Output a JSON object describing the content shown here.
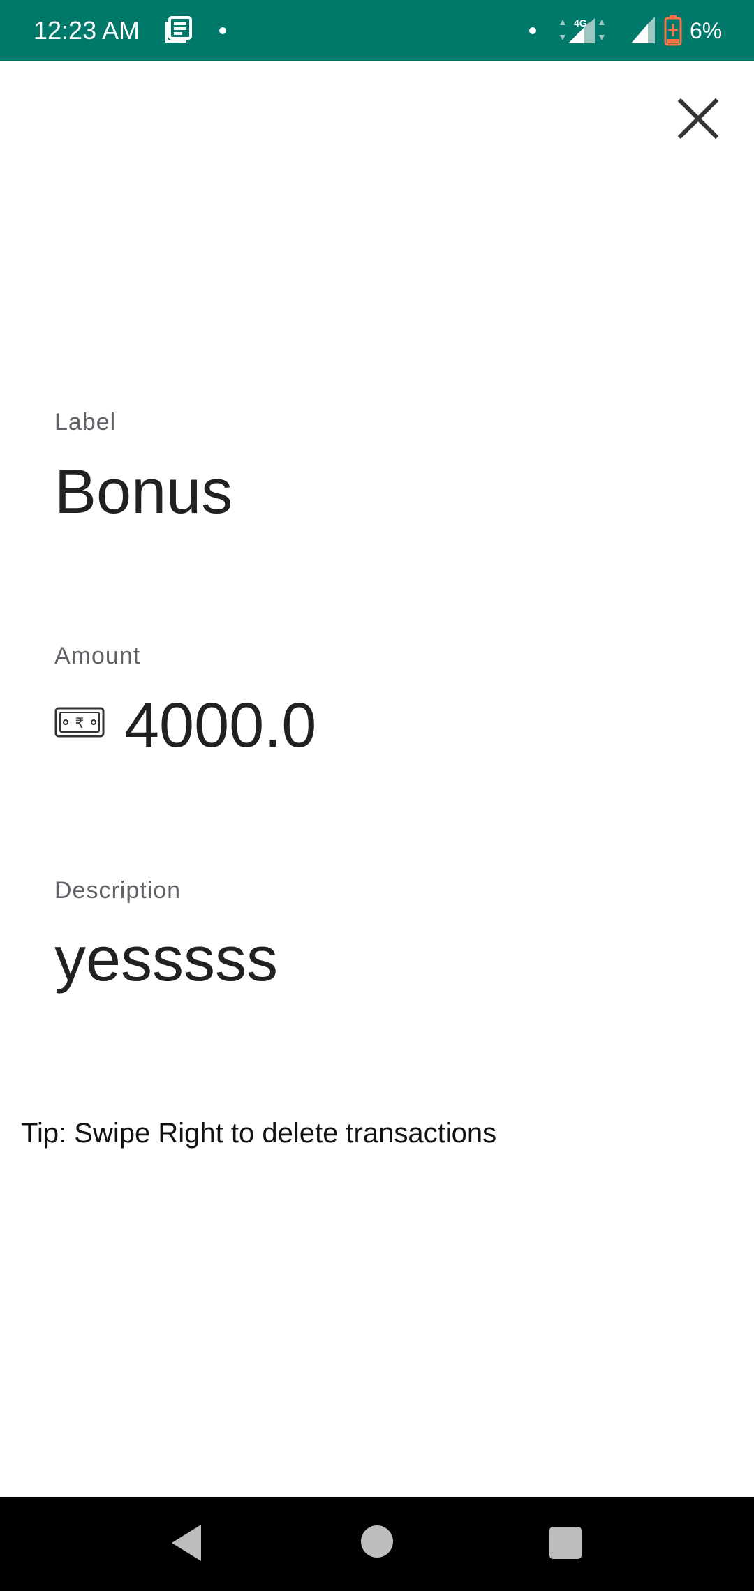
{
  "status_bar": {
    "time": "12:23 AM",
    "network": "4G",
    "battery": "6%",
    "icons": [
      "news-icon",
      "signal-icon",
      "battery-icon"
    ]
  },
  "dialog": {
    "close_icon": "close-icon",
    "label": {
      "caption": "Label",
      "value": "Bonus"
    },
    "amount": {
      "caption": "Amount",
      "value": "4000.0",
      "icon": "rupee-note-icon"
    },
    "description": {
      "caption": "Description",
      "value": "yesssss"
    },
    "tip": "Tip: Swipe Right to delete transactions"
  },
  "nav_bar": {
    "icons": [
      "back-icon",
      "home-icon",
      "recents-icon"
    ]
  },
  "colors": {
    "status_bar": "#00796b",
    "caption_text": "#5f6368",
    "value_text": "#212121",
    "battery_low": "#ff7043"
  }
}
